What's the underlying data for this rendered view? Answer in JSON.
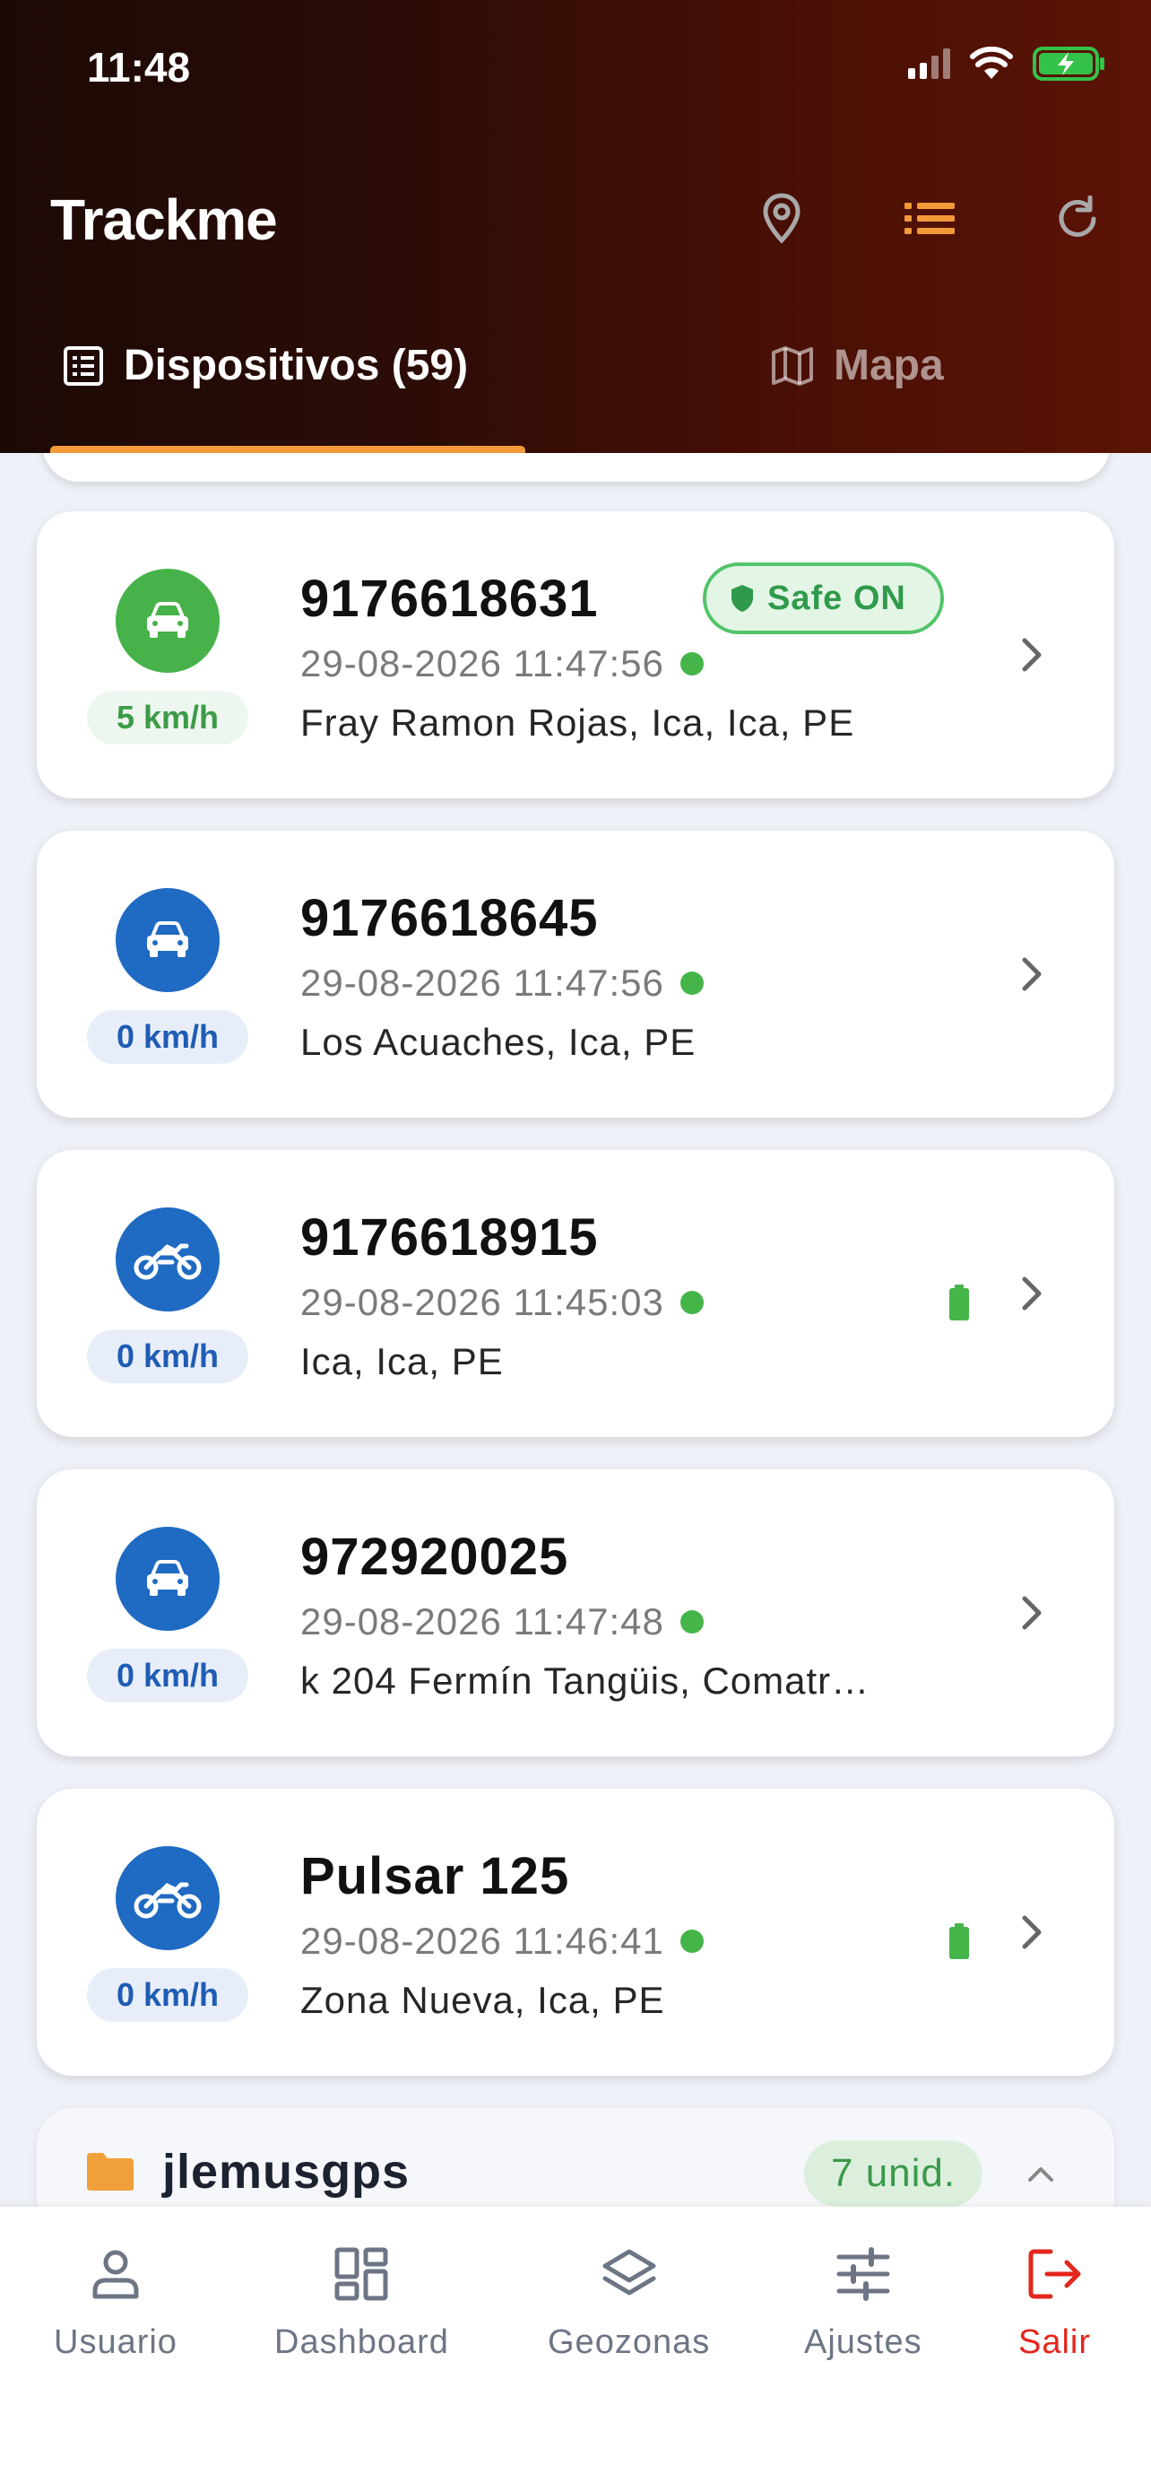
{
  "status_bar": {
    "time": "11:48"
  },
  "header": {
    "title": "Trackme",
    "tabs": [
      {
        "label": "Dispositivos (59)",
        "active": true
      },
      {
        "label": "Mapa",
        "active": false
      }
    ]
  },
  "devices": [
    {
      "name": "9176618631",
      "time": "29-08-2026 11:47:56",
      "address": "Fray Ramon Rojas, Ica, Ica, PE",
      "speed": "5 km/h",
      "icon": "car-icon",
      "color": "#46b249",
      "badge": "Safe ON",
      "battery": false
    },
    {
      "name": "9176618645",
      "time": "29-08-2026 11:47:56",
      "address": "Los Acuaches, Ica, PE",
      "speed": "0 km/h",
      "icon": "car-icon",
      "color": "#1f6ac2",
      "battery": false
    },
    {
      "name": "9176618915",
      "time": "29-08-2026 11:45:03",
      "address": "Ica, Ica, PE",
      "speed": "0 km/h",
      "icon": "motorcycle-icon",
      "color": "#1f6ac2",
      "battery": true
    },
    {
      "name": "972920025",
      "time": "29-08-2026 11:47:48",
      "address": "k 204 Fermín Tangüis, Comatr…",
      "speed": "0 km/h",
      "icon": "car-icon",
      "color": "#1f6ac2",
      "battery": false
    },
    {
      "name": "Pulsar 125",
      "time": "29-08-2026 11:46:41",
      "address": "Zona Nueva, Ica, PE",
      "speed": "0 km/h",
      "icon": "motorcycle-icon",
      "color": "#1f6ac2",
      "battery": true
    }
  ],
  "group": {
    "name": "jlemusgps",
    "count": "7 unid."
  },
  "bottom_nav": [
    {
      "label": "Usuario",
      "icon": "user-icon"
    },
    {
      "label": "Dashboard",
      "icon": "dashboard-icon"
    },
    {
      "label": "Geozonas",
      "icon": "layers-icon"
    },
    {
      "label": "Ajustes",
      "icon": "sliders-icon"
    },
    {
      "label": "Salir",
      "icon": "logout-icon"
    }
  ]
}
